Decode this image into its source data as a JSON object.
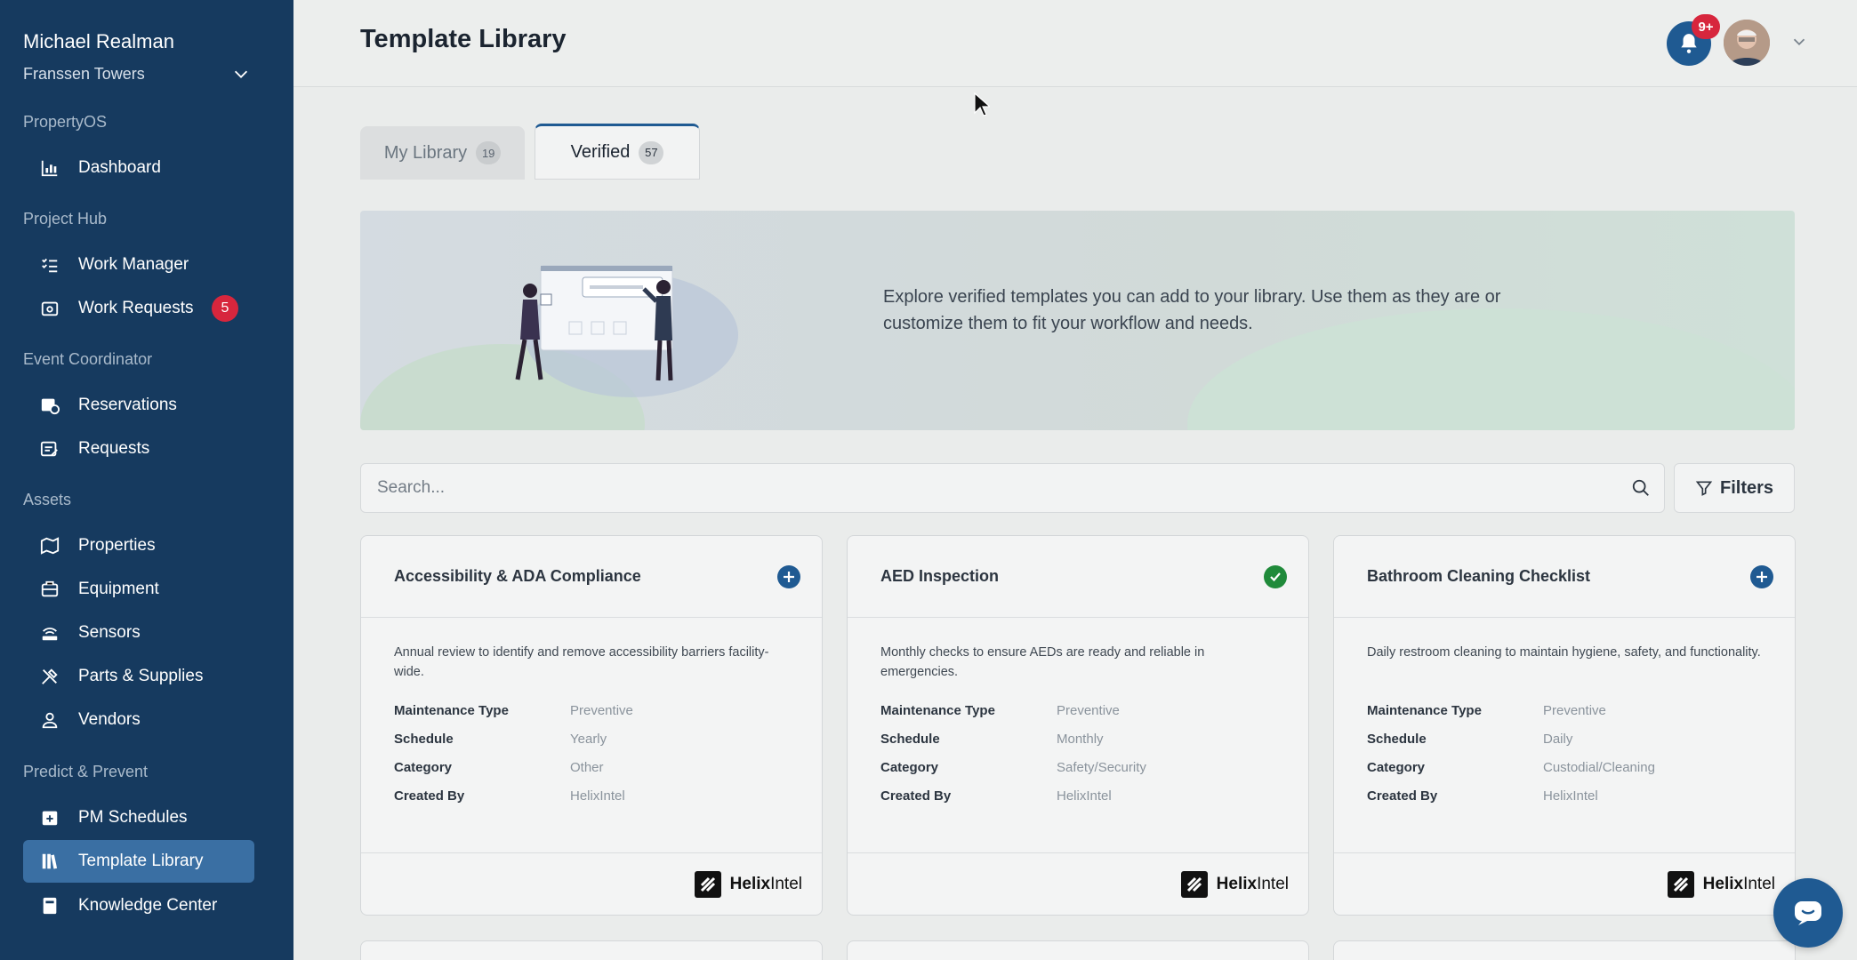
{
  "sidebar": {
    "user_name": "Michael Realman",
    "property_name": "Franssen Towers",
    "sections": {
      "propertyos": "PropertyOS",
      "project_hub": "Project Hub",
      "event_coordinator": "Event Coordinator",
      "assets": "Assets",
      "predict_prevent": "Predict & Prevent"
    },
    "items": {
      "dashboard": "Dashboard",
      "work_manager": "Work Manager",
      "work_requests": "Work Requests",
      "work_requests_badge": "5",
      "reservations": "Reservations",
      "requests": "Requests",
      "properties": "Properties",
      "equipment": "Equipment",
      "sensors": "Sensors",
      "parts_supplies": "Parts & Supplies",
      "vendors": "Vendors",
      "pm_schedules": "PM Schedules",
      "template_library": "Template Library",
      "knowledge_center": "Knowledge Center"
    },
    "active_item": "Template Library"
  },
  "header": {
    "title": "Template Library",
    "notification_badge": "9+"
  },
  "tabs": {
    "my_library": {
      "label": "My Library",
      "count": "19"
    },
    "verified": {
      "label": "Verified",
      "count": "57"
    },
    "active": "Verified"
  },
  "banner": {
    "text": "Explore verified templates you can add to your library. Use them as they are or customize them to fit your workflow and needs."
  },
  "search": {
    "placeholder": "Search...",
    "value": "",
    "filters_label": "Filters"
  },
  "field_labels": {
    "maintenance_type": "Maintenance Type",
    "schedule": "Schedule",
    "category": "Category",
    "created_by": "Created By"
  },
  "brand": {
    "bold": "Helix",
    "light": "Intel"
  },
  "cards": [
    {
      "title": "Accessibility & ADA Compliance",
      "status": "add",
      "description": "Annual review to identify and remove accessibility barriers facility-wide.",
      "maintenance_type": "Preventive",
      "schedule": "Yearly",
      "category": "Other",
      "created_by": "HelixIntel"
    },
    {
      "title": "AED Inspection",
      "status": "added",
      "description": "Monthly checks to ensure AEDs are ready and reliable in emergencies.",
      "maintenance_type": "Preventive",
      "schedule": "Monthly",
      "category": "Safety/Security",
      "created_by": "HelixIntel"
    },
    {
      "title": "Bathroom Cleaning Checklist",
      "status": "add",
      "description": "Daily restroom cleaning to maintain hygiene, safety, and functionality.",
      "maintenance_type": "Preventive",
      "schedule": "Daily",
      "category": "Custodial/Cleaning",
      "created_by": "HelixIntel"
    }
  ],
  "colors": {
    "sidebar_bg": "#163a5f",
    "active_item_bg": "#3a6fa3",
    "accent": "#1f5a92",
    "badge_red": "#d7263d",
    "added_green": "#1f8a3a"
  }
}
